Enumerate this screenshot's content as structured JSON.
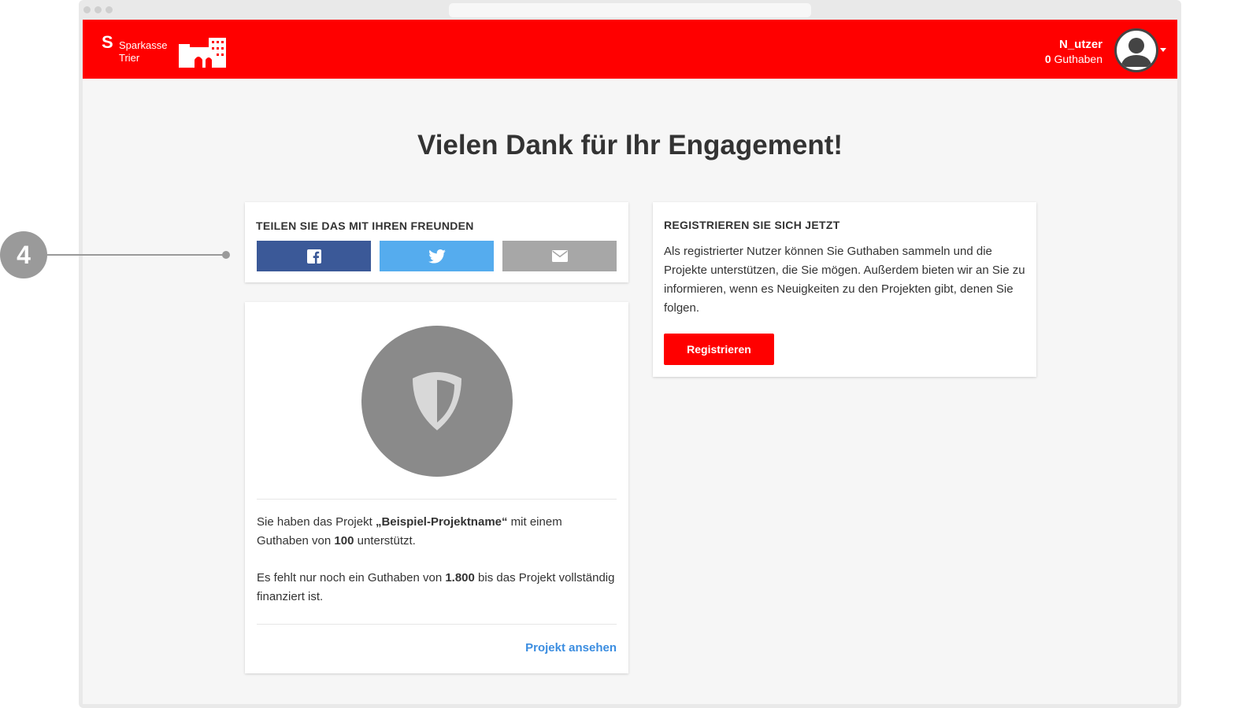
{
  "header": {
    "brand_symbol": "S",
    "brand_line1": "Sparkasse",
    "brand_line2": "Trier",
    "user_name": "N_utzer",
    "credit_value": "0",
    "credit_label": "Guthaben"
  },
  "main": {
    "title": "Vielen Dank für Ihr Engagement!"
  },
  "share": {
    "heading": "TEILEN SIE DAS MIT IHREN FREUNDEN",
    "buttons": [
      {
        "icon": "facebook-icon",
        "color": "#3b5998"
      },
      {
        "icon": "twitter-icon",
        "color": "#55acee"
      },
      {
        "icon": "email-icon",
        "color": "#a7a7a7"
      }
    ]
  },
  "register": {
    "heading": "REGISTRIEREN SIE SICH JETZT",
    "text": "Als registrierter Nutzer können Sie Guthaben sammeln und die Projekte unterstützen, die Sie mögen. Außerdem bieten wir an Sie zu informieren, wenn es Neuigkeiten zu den Projekten gibt, denen Sie folgen.",
    "button_label": "Registrieren"
  },
  "project": {
    "icon": "shield-icon",
    "p1_pre": "Sie haben das Projekt ",
    "p1_name": "„Beispiel-Projektname“",
    "p1_mid": " mit einem Guthaben von ",
    "p1_amount": "100",
    "p1_post": " unterstützt.",
    "p2_pre": "Es fehlt nur noch ein Guthaben von ",
    "p2_amount": "1.800",
    "p2_post": " bis das Projekt vollständig finanziert ist.",
    "link_label": "Projekt ansehen"
  },
  "annotation": {
    "number": "4"
  },
  "colors": {
    "brand_red": "#ff0000",
    "link_blue": "#3b8de0",
    "facebook": "#3b5998",
    "twitter": "#55acee",
    "email": "#a7a7a7"
  }
}
